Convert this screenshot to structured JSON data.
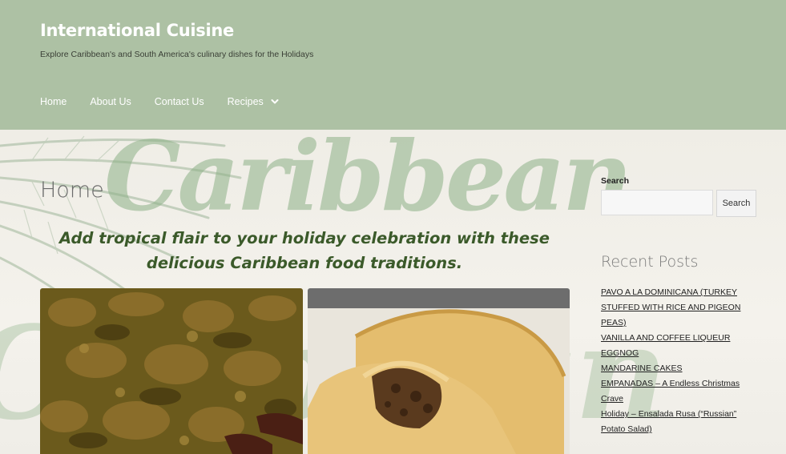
{
  "site": {
    "title": "International Cuisine",
    "tagline": "Explore Caribbean's and South America's culinary dishes for the Holidays"
  },
  "nav": {
    "items": [
      "Home",
      "About Us",
      "Contact Us",
      "Recipes"
    ]
  },
  "hero": {
    "background_word": "Caribbean"
  },
  "page": {
    "heading": "Home",
    "intro": "Add tropical flair to your holiday celebration with these delicious Caribbean food traditions."
  },
  "sidebar": {
    "search_label": "Search",
    "search_value": "",
    "search_button": "Search",
    "recent_title": "Recent Posts",
    "recent_posts": [
      "PAVO A LA DOMINICANA (TURKEY STUFFED WITH RICE AND PIGEON PEAS)",
      "VANILLA AND COFFEE LIQUEUR EGGNOG",
      "MANDARINE CAKES",
      "EMPANADAS – A Endless Christmas Crave",
      "Holiday – Ensalada Rusa (“Russian” Potato Salad)"
    ]
  },
  "colors": {
    "header_bg": "#adc1a4",
    "intro_text": "#3b5a2a",
    "background_script": "#8db187"
  },
  "icons": {
    "recipes_dropdown": "chevron-down-icon"
  }
}
